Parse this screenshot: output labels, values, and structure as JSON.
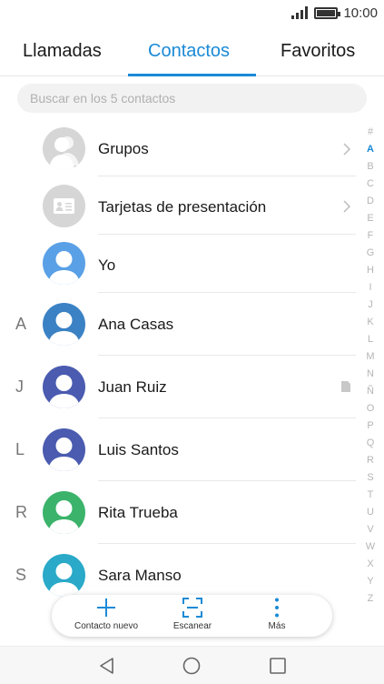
{
  "status_bar": {
    "time": "10:00",
    "signal_icon": "signal-icon",
    "battery_icon": "battery-icon"
  },
  "tabs": [
    {
      "label": "Llamadas",
      "active": false
    },
    {
      "label": "Contactos",
      "active": true
    },
    {
      "label": "Favoritos",
      "active": false
    }
  ],
  "search": {
    "placeholder": "Buscar en los 5 contactos",
    "value": ""
  },
  "special_rows": [
    {
      "label": "Grupos",
      "icon": "group-icon"
    },
    {
      "label": "Tarjetas de presentación",
      "icon": "business-card-icon"
    },
    {
      "label": "Yo",
      "icon": "profile-icon"
    }
  ],
  "contacts": [
    {
      "letter": "A",
      "name": "Ana Casas",
      "color": "#3b82c4"
    },
    {
      "letter": "J",
      "name": "Juan Ruiz",
      "color": "#4a5bb0"
    },
    {
      "letter": "L",
      "name": "Luis Santos",
      "color": "#4a5bb0"
    },
    {
      "letter": "R",
      "name": "Rita Trueba",
      "color": "#3bb36a"
    },
    {
      "letter": "S",
      "name": "Sara Manso",
      "color": "#2aa9c9"
    }
  ],
  "alphabet_index": [
    "#",
    "A",
    "B",
    "C",
    "D",
    "E",
    "F",
    "G",
    "H",
    "I",
    "J",
    "K",
    "L",
    "M",
    "N",
    "Ñ",
    "O",
    "P",
    "Q",
    "R",
    "S",
    "T",
    "U",
    "V",
    "W",
    "X",
    "Y",
    "Z"
  ],
  "alphabet_active": "A",
  "colors": {
    "accent": "#1a8ad6",
    "me_avatar": "#5aa0e6",
    "grey_avatar": "#d6d6d6"
  },
  "bottom_bar": {
    "new_contact": "Contacto nuevo",
    "scan": "Escanear",
    "more": "Más"
  },
  "nav": {
    "back": "back-icon",
    "home": "home-icon",
    "recents": "recents-icon"
  }
}
